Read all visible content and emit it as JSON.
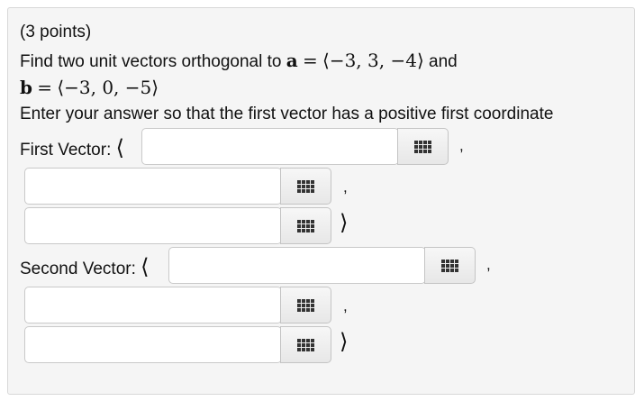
{
  "question": {
    "points": "(3 points)",
    "prompt_prefix": "Find two unit vectors orthogonal to",
    "vec_a_name": "a",
    "vec_a_value": "⟨−3, 3, −4⟩",
    "and_text": "and",
    "vec_b_name": "b",
    "vec_b_value": "⟨−3, 0, −5⟩",
    "equals": "=",
    "instruction": "Enter your answer so that the first vector has a positive first coordinate"
  },
  "first_vector": {
    "label": "First Vector:",
    "open_bracket": "⟨",
    "comma": ",",
    "close_bracket": "⟩",
    "components": [
      "",
      "",
      ""
    ]
  },
  "second_vector": {
    "label": "Second Vector:",
    "open_bracket": "⟨",
    "comma": ",",
    "close_bracket": "⟩",
    "components": [
      "",
      "",
      ""
    ]
  },
  "icons": {
    "keypad": "keypad-grid-icon"
  }
}
